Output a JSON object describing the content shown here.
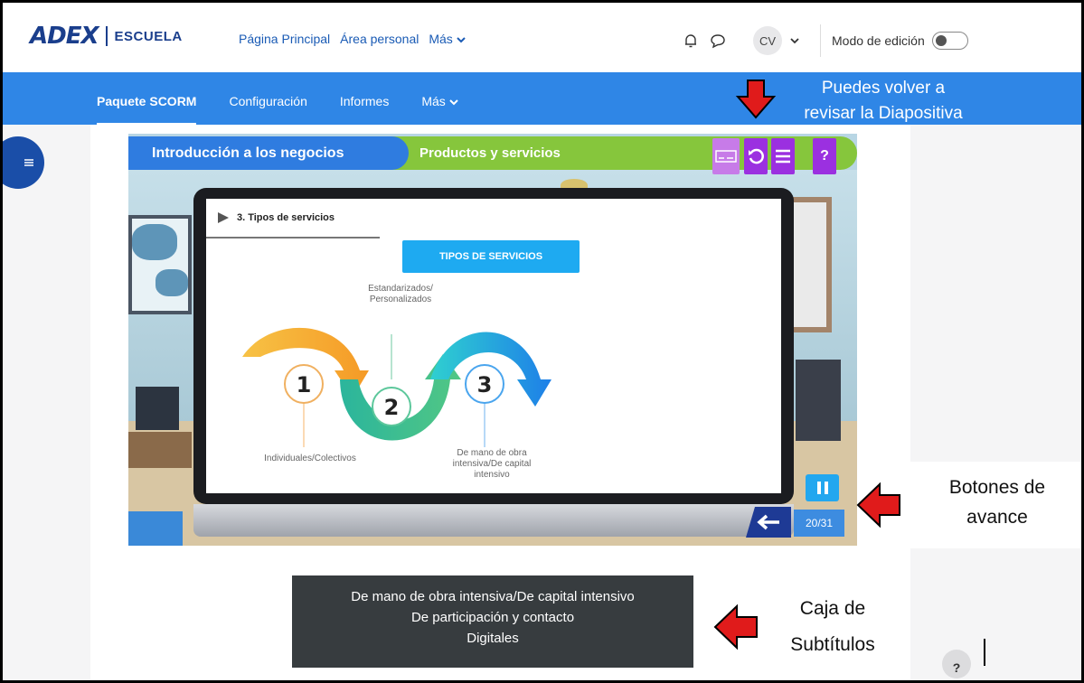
{
  "app": {
    "logo_main": "ADEX",
    "logo_sub": "ESCUELA"
  },
  "topnav": {
    "home": "Página Principal",
    "personal": "Área personal",
    "more": "Más",
    "avatar_initials": "CV",
    "edit_mode_label": "Modo de edición"
  },
  "subnav": {
    "items": [
      {
        "label": "Paquete SCORM"
      },
      {
        "label": "Configuración"
      },
      {
        "label": "Informes"
      },
      {
        "label": "Más"
      }
    ]
  },
  "player": {
    "course_title": "Introducción a los negocios",
    "section_title": "Productos y servicios",
    "help_label": "?",
    "slide_title": "3. Tipos de servicios",
    "box_label": "TIPOS DE SERVICIOS",
    "steps": [
      "1",
      "2",
      "3"
    ],
    "label_top": "Estandarizados/ Personalizados",
    "label_left": "Individuales/Colectivos",
    "label_right": "De mano de obra intensiva/De capital intensivo",
    "counter": "20/31"
  },
  "subtitles": {
    "line1": "De mano de obra intensiva/De capital intensivo",
    "line2": "De participación y contacto",
    "line3": "Digitales"
  },
  "annotations": {
    "top_line1": "Puedes volver a",
    "top_line2": "revisar la Diapositiva",
    "right_line1": "Botones de",
    "right_line2": "avance",
    "sub_line1": "Caja de",
    "sub_line2": "Subtítulos"
  },
  "colors": {
    "brand_blue": "#1a3e8c",
    "nav_blue": "#2f86e6",
    "header_green": "#86c63c",
    "control_purple": "#9b30e0",
    "annotation_red": "#e01b1b"
  },
  "help_footer": "?"
}
